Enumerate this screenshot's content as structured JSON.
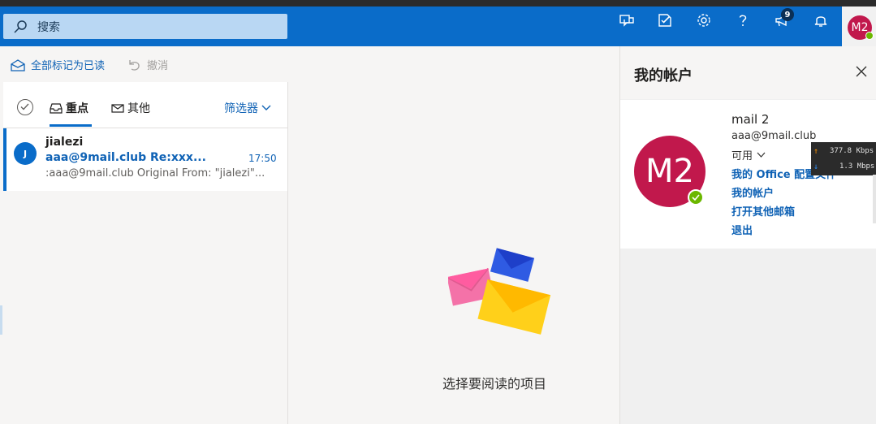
{
  "search": {
    "placeholder": "搜索",
    "icon": "search-icon"
  },
  "header": {
    "icons": [
      "chat-icon",
      "compose-note-icon",
      "gear-icon",
      "help-icon",
      "megaphone-icon",
      "bell-icon"
    ],
    "notification_count": "9",
    "avatar_initials": "M2"
  },
  "toolbar": {
    "mark_all_read": "全部标记为已读",
    "undo": "撤消"
  },
  "list": {
    "tabs": [
      {
        "label": "重点",
        "icon": "inbox-icon",
        "active": true
      },
      {
        "label": "其他",
        "icon": "mail-icon",
        "active": false
      }
    ],
    "filter_label": "筛选器",
    "items": [
      {
        "avatar": "J",
        "from": "jialezi",
        "subject": "aaa@9mail.club Re:xxx...",
        "time": "17:50",
        "preview": ":aaa@9mail.club Original From: \"jialezi\"..."
      }
    ]
  },
  "reading": {
    "empty_text": "选择要阅读的项目"
  },
  "account": {
    "title": "我的帐户",
    "avatar_initials": "M2",
    "name": "mail 2",
    "email": "aaa@9mail.club",
    "status": "可用",
    "links": [
      "我的 Office 配置文件",
      "我的帐户",
      "打开其他邮箱",
      "退出"
    ]
  },
  "net_monitor": {
    "upload": "377.8 Kbps",
    "download": "1.3 Mbps"
  },
  "colors": {
    "brand_blue": "#0a6cc9",
    "avatar_red": "#c1184c",
    "status_green": "#6bb700",
    "link_blue": "#0f62b5"
  }
}
